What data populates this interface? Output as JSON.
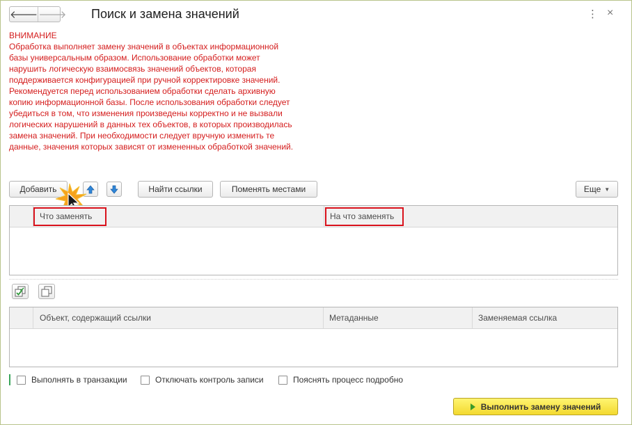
{
  "window": {
    "title": "Поиск и замена значений",
    "back_glyph": "🡐",
    "forward_glyph": "🡒",
    "more_glyph": "⋮",
    "close_glyph": "×"
  },
  "warning": {
    "heading": "ВНИМАНИЕ",
    "text": "Обработка выполняет замену значений в объектах информационной базы универсальным образом.  Использование обработки может нарушить логическую взаимосвязь значений объектов, которая поддерживается конфигурацией при ручной корректировке значений. Рекомендуется перед использованием обработки сделать архивную копию информационной базы. После использования обработки следует убедиться в том, что изменения произведены корректно и не вызвали логических нарушений в данных тех объектов, в которых производилась замена значений. При необходимости следует вручную изменить те данные, значения которых зависят от измененных обработкой значений."
  },
  "toolbar": {
    "add_label": "Добавить",
    "find_refs_label": "Найти ссылки",
    "swap_label": "Поменять местами",
    "more_label": "Еще",
    "up_icon": "arrow-up-icon",
    "down_icon": "arrow-down-icon"
  },
  "replace_table": {
    "columns": [
      "Что заменять",
      "На что заменять"
    ],
    "rows": []
  },
  "refs_toolbar": {
    "icons": [
      "check-all-icon",
      "copy-icon"
    ]
  },
  "refs_table": {
    "columns": [
      "Объект, содержащий ссылки",
      "Метаданные",
      "Заменяемая ссылка"
    ],
    "rows": []
  },
  "options": {
    "transaction_label": "Выполнять в транзакции",
    "disable_control_label": "Отключать контроль записи",
    "verbose_label": "Пояснять процесс подробно"
  },
  "execute_label": "Выполнить замену значений",
  "colors": {
    "warning": "#d41c1c",
    "highlight": "#d9121c",
    "execute_bg": "#f7e13a",
    "arrow_blue": "#2f86d9"
  }
}
